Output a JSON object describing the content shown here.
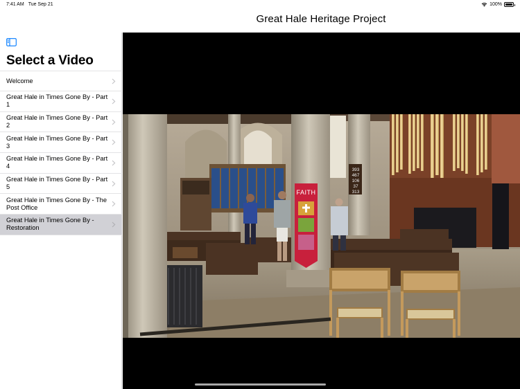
{
  "status_bar": {
    "time": "7:41 AM",
    "date": "Tue Sep 21",
    "battery_text": "100%",
    "battery_level": 1.0
  },
  "nav": {
    "title": "Great Hale Heritage Project"
  },
  "sidebar": {
    "toggle_icon": "sidebar-toggle-icon",
    "heading": "Select a Video",
    "items": [
      {
        "label": "Welcome",
        "selected": false
      },
      {
        "label": "Great Hale in Times Gone By - Part 1",
        "selected": false
      },
      {
        "label": "Great Hale in Times Gone By - Part 2",
        "selected": false
      },
      {
        "label": "Great Hale in Times Gone By - Part 3",
        "selected": false
      },
      {
        "label": "Great Hale in Times Gone By - Part 4",
        "selected": false
      },
      {
        "label": "Great Hale in Times Gone By - Part 5",
        "selected": false
      },
      {
        "label": "Great Hale in Times Gone By - The Post Office",
        "selected": false
      },
      {
        "label": "Great Hale in Times Gone By - Restoration",
        "selected": true
      }
    ]
  },
  "video": {
    "banner_text": "FAITH",
    "hymn_numbers": [
      "393",
      "467",
      "106",
      "37",
      "313"
    ]
  },
  "colors": {
    "accent": "#007aff",
    "selected_row": "#d1d1d6",
    "separator": "#e3e3e5",
    "banner": "#c8203c"
  }
}
